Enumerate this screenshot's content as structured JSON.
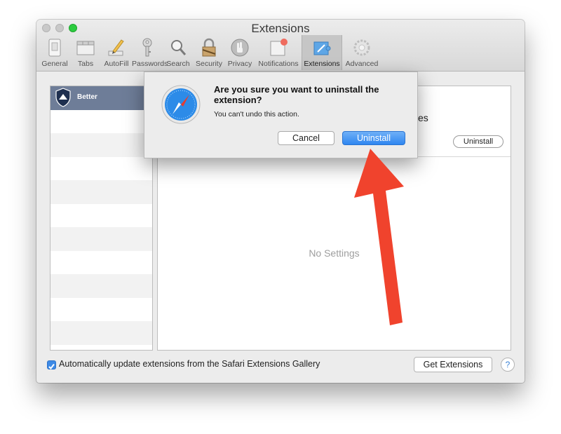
{
  "window": {
    "title": "Extensions"
  },
  "toolbar": {
    "tabs": [
      {
        "label": "General",
        "icon": "switch-icon"
      },
      {
        "label": "Tabs",
        "icon": "tabs-icon"
      },
      {
        "label": "AutoFill",
        "icon": "pencil-icon"
      },
      {
        "label": "Passwords",
        "icon": "key-icon"
      },
      {
        "label": "Search",
        "icon": "magnifier-icon"
      },
      {
        "label": "Security",
        "icon": "lock-icon"
      },
      {
        "label": "Privacy",
        "icon": "hand-icon"
      },
      {
        "label": "Notifications",
        "icon": "notification-icon"
      },
      {
        "label": "Extensions",
        "icon": "puzzle-icon"
      },
      {
        "label": "Advanced",
        "icon": "gear-icon"
      }
    ],
    "active_tab": "Extensions"
  },
  "sidebar": {
    "items": [
      {
        "label": "Better",
        "icon": "shield-icon"
      }
    ]
  },
  "detail": {
    "title_fragment": "kes",
    "uninstall_label": "Uninstall",
    "empty_text": "No Settings"
  },
  "footer": {
    "auto_update_label": "Automatically update extensions from the Safari Extensions Gallery",
    "auto_update_checked": true,
    "get_extensions_label": "Get Extensions",
    "help_label": "?"
  },
  "dialog": {
    "title": "Are you sure you want to uninstall the extension?",
    "message": "You can't undo this action.",
    "cancel_label": "Cancel",
    "confirm_label": "Uninstall"
  },
  "colors": {
    "accent": "#2f86f0",
    "selection": "#6e7d98",
    "annotation_arrow": "#f0432d"
  }
}
